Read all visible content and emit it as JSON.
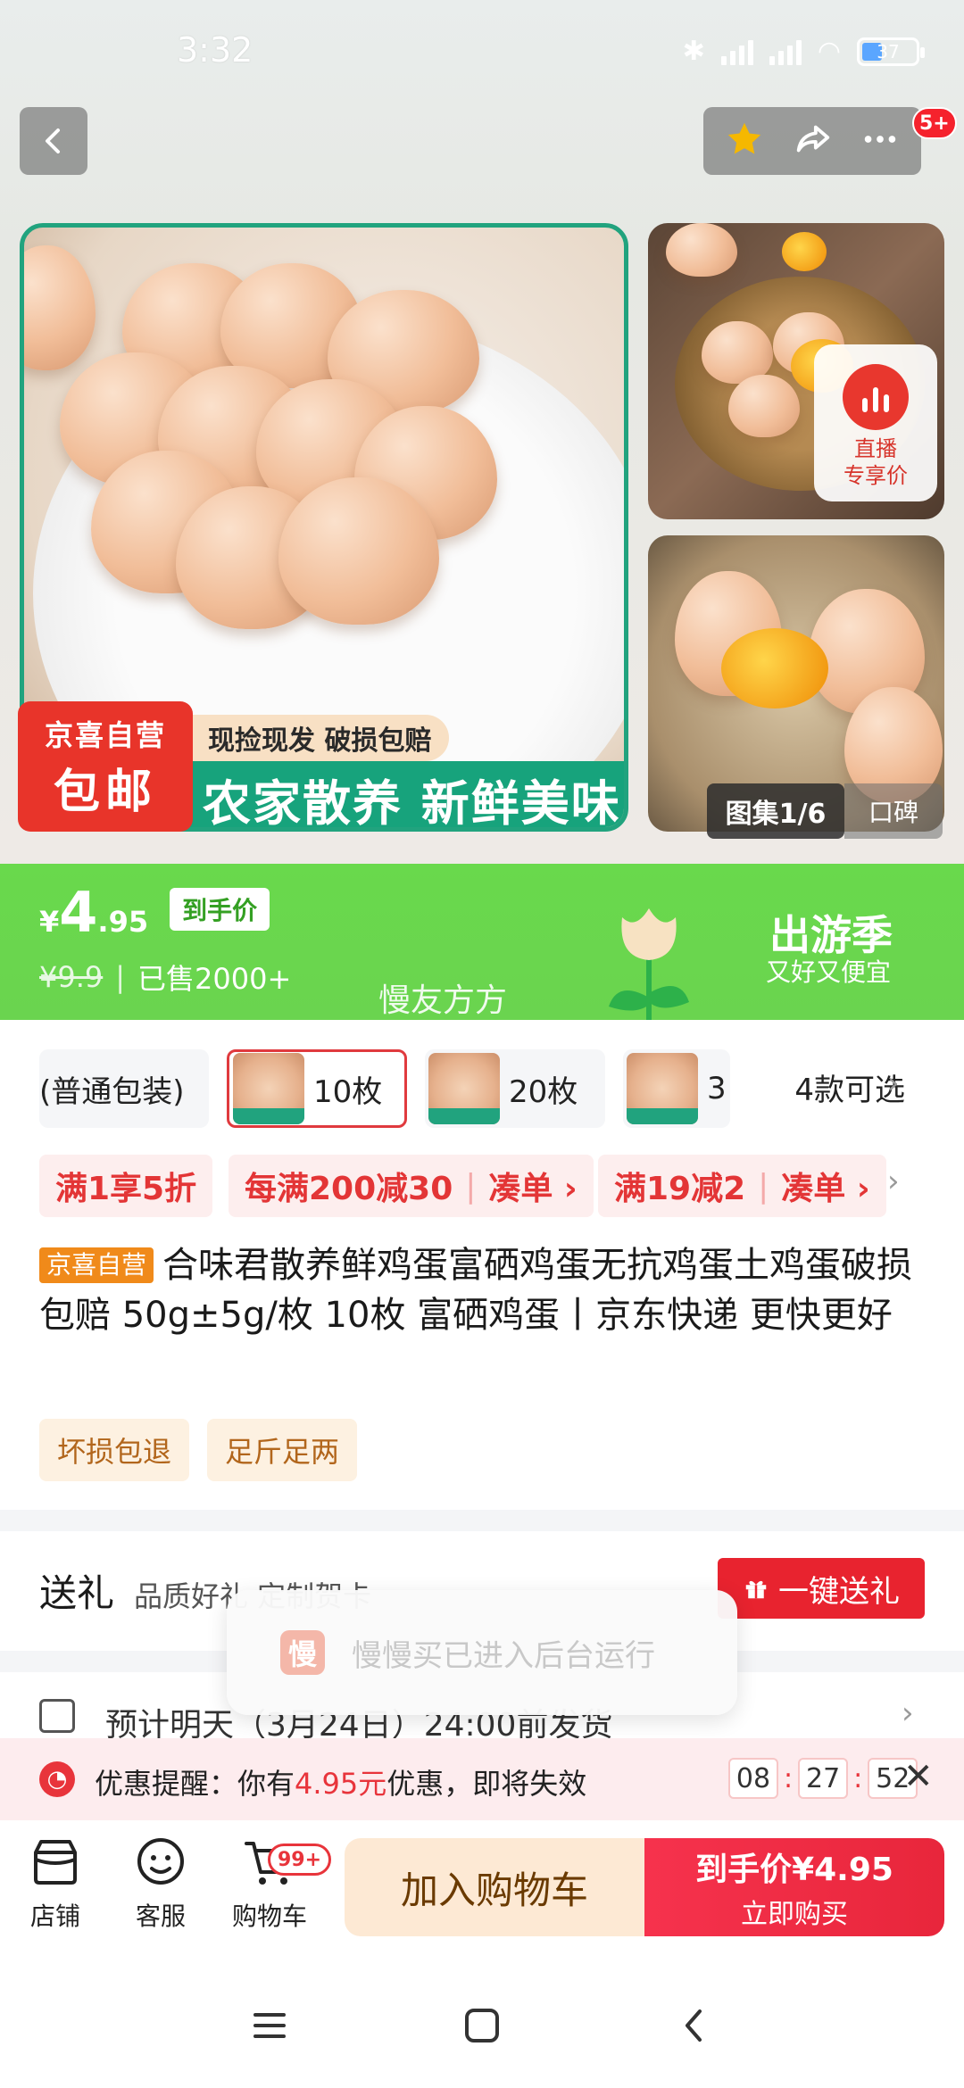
{
  "status_bar": {
    "time": "3:32",
    "battery": "37"
  },
  "header": {
    "notification_badge": "5+"
  },
  "gallery": {
    "banner_tag": "现捡现发 破损包赔",
    "banner_main": "农家散养 新鲜美味",
    "badge_line1": "京喜自营",
    "badge_line2": "包邮",
    "live_line1": "直播",
    "live_line2": "专享价",
    "counter": "图集1/6",
    "reviews": "口碑"
  },
  "price": {
    "currency": "¥",
    "integer": "4",
    "decimal": ".95",
    "tag": "到手价",
    "original": "¥9.9",
    "sold": "已售2000+",
    "campaign_title": "出游季",
    "campaign_sub": "又好又便宜",
    "watermark": "慢友方方"
  },
  "sku": {
    "options": [
      "(普通包装)",
      "10枚",
      "20枚",
      "3"
    ],
    "more": "4款可选"
  },
  "promos": [
    {
      "text": "满1享5折"
    },
    {
      "text": "每满200减30",
      "action": "凑单 ›"
    },
    {
      "text": "满19减2",
      "action": "凑单 ›"
    }
  ],
  "product": {
    "tag": "京喜自营",
    "title": "合味君散养鲜鸡蛋富硒鸡蛋无抗鸡蛋土鸡蛋破损包赔 50g±5g/枚 10枚 富硒鸡蛋丨京东快递 更快更好",
    "features": [
      "坏损包退",
      "足斤足两"
    ]
  },
  "gift": {
    "label": "送礼",
    "sub": "品质好礼 定制贺卡",
    "button": "一键送礼"
  },
  "shipping": {
    "text": "预计明天（3月24日）24:00前发货"
  },
  "toast": {
    "icon": "慢",
    "text": "慢慢买已进入后台运行"
  },
  "reminder": {
    "prefix": "优惠提醒：你有",
    "amount": "4.95元",
    "suffix": "优惠，即将失效",
    "hh": "08",
    "mm": "27",
    "ss": "52"
  },
  "bottom_bar": {
    "shop": "店铺",
    "service": "客服",
    "cart": "购物车",
    "cart_badge": "99+",
    "add_cart": "加入购物车",
    "buy_line1": "到手价¥4.95",
    "buy_line2": "立即购买"
  },
  "colors": {
    "accent_red": "#e8343b",
    "band_green": "#69d94c",
    "brand_green": "#17a37c"
  }
}
